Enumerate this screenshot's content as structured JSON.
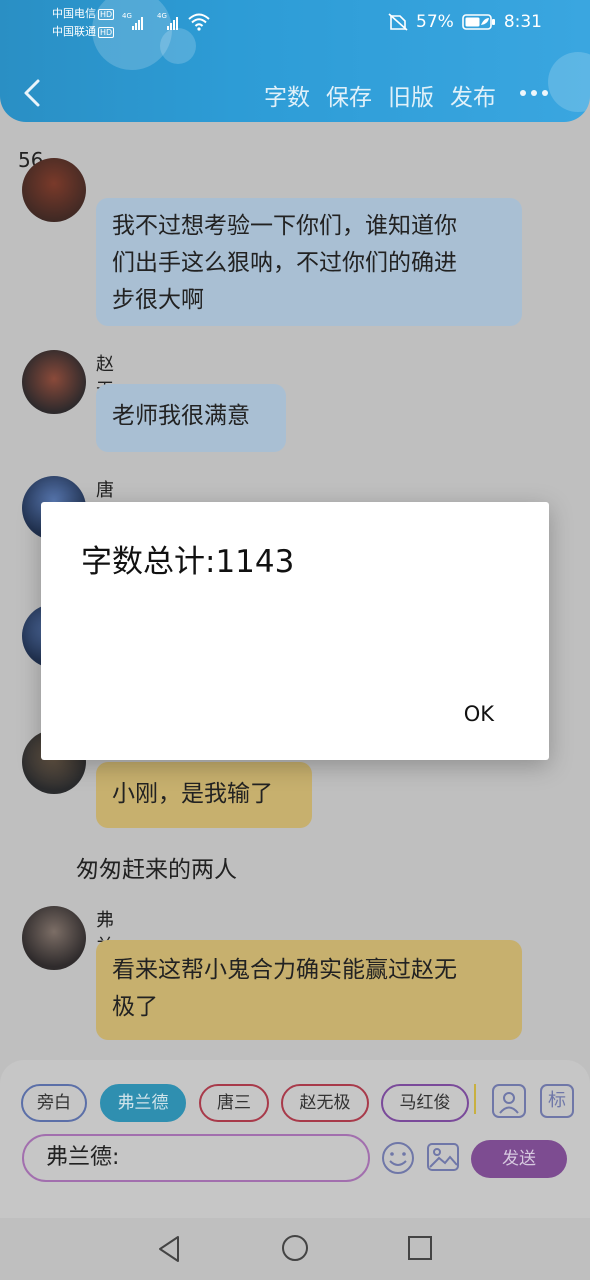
{
  "status_bar": {
    "carrier1": "中国电信",
    "carrier2": "中国联通",
    "hd": "HD",
    "net1": "4G",
    "net2": "4G",
    "battery_percent": "57%",
    "time": "8:31"
  },
  "toolbar": {
    "word_count": "字数",
    "save": "保存",
    "old_version": "旧版",
    "publish": "发布"
  },
  "content": {
    "count_line": "56",
    "messages": [
      {
        "name": "",
        "text_lines": [
          "我不过想考验一下你们，谁知道你",
          "们出手这么狠呐，不过你们的确进",
          "步很大啊"
        ]
      },
      {
        "name": "赵无极",
        "text_lines": [
          "老师我很满意"
        ]
      },
      {
        "name": "唐三",
        "text_lines": []
      },
      {
        "name": "",
        "text_lines": [
          "小刚，是我输了"
        ]
      },
      {
        "name": "弗兰德",
        "text_lines": [
          "看来这帮小鬼合力确实能赢过赵无",
          "极了"
        ]
      }
    ],
    "narration": "匆匆赶来的两人"
  },
  "composer": {
    "chips": [
      "旁白",
      "弗兰德",
      "唐三",
      "赵无极",
      "马红俊"
    ],
    "tag_button": "标",
    "input_value": "弗兰德:",
    "send": "发送"
  },
  "dialog": {
    "message": "字数总计:1143",
    "ok": "OK"
  }
}
